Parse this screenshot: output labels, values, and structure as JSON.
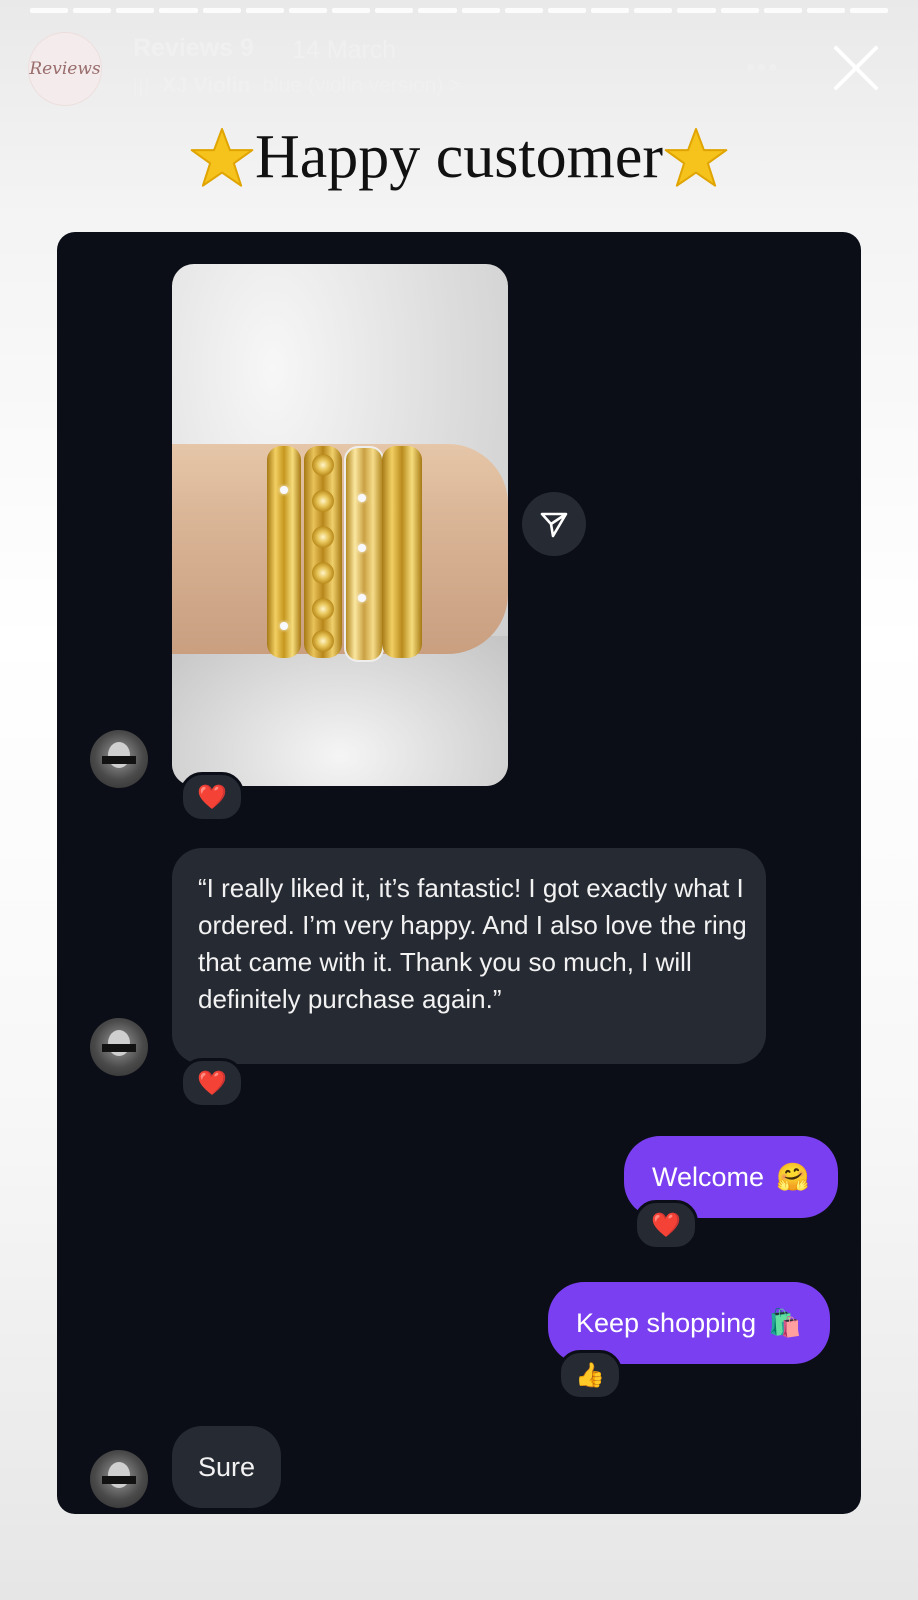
{
  "story": {
    "brand_avatar_text": "Reviews",
    "title": "Reviews 9",
    "date": "14 March",
    "music": {
      "bars": "|||",
      "artist": "XJ Violin",
      "song": "blue (violin version) >"
    }
  },
  "headline": {
    "text": "Happy customer"
  },
  "chat": {
    "messages": {
      "review": "“I really liked it, it’s fantastic! I got exactly what I ordered. I’m very happy. And I also love the ring that came with it. Thank you so much, I will definitely purchase again.”",
      "welcome": "Welcome",
      "keep_shopping": "Keep shopping",
      "sure": "Sure"
    },
    "reactions": {
      "photo": "❤️",
      "review": "❤️",
      "welcome": "❤️",
      "keep_shopping": "👍"
    },
    "emojis": {
      "welcome": "🤗",
      "keep_shopping": "🛍️"
    }
  },
  "colors": {
    "chat_bg": "#0b0e17",
    "incoming_bubble": "#262a33",
    "outgoing_bubble": "#7a3ff0",
    "star": "#f6c21c"
  }
}
